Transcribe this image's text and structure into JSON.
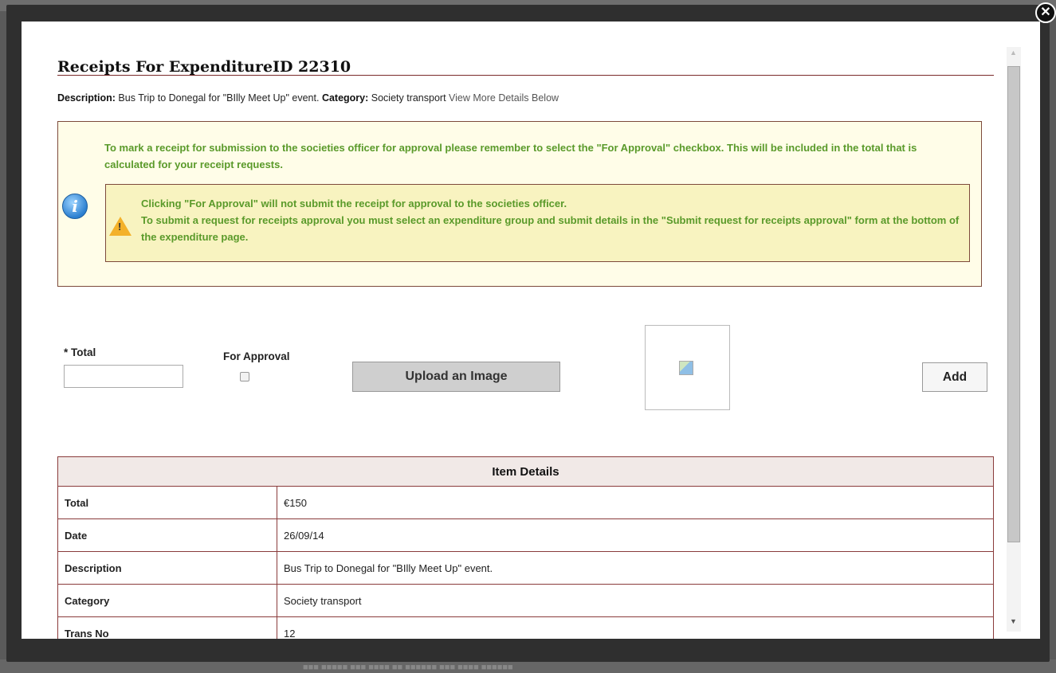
{
  "background": {
    "footer_text": "■■■ ■■■■■ ■■■ ■■■■ ■■ ■■■■■■ ■■■ ■■■■ ■■■■■■"
  },
  "modal": {
    "close_symbol": "✕",
    "title": "Receipts For ExpenditureID 22310",
    "description_label": "Description:",
    "description_value": " Bus Trip to Donegal for \"BIlly Meet Up\" event. ",
    "category_label": "Category:",
    "category_value": " Society transport ",
    "view_more_link": "View More Details Below",
    "info_text": "To mark a receipt for submission to the societies officer for approval please remember to select the \"For Approval\" checkbox. This will be included in the total that is calculated for your receipt requests.",
    "warning_line1": "Clicking \"For Approval\" will not submit the receipt for approval to the societies officer.",
    "warning_line2": "To submit a request for receipts approval you must select an expenditure group and submit details in the \"Submit request for receipts approval\" form at the bottom of the expenditure page.",
    "icons": {
      "info": "i",
      "warning": "!"
    }
  },
  "form": {
    "total_label": "* Total",
    "total_value": "",
    "for_approval_label": "For Approval",
    "for_approval_checked": false,
    "upload_button": "Upload an Image",
    "add_button": "Add"
  },
  "details": {
    "header": "Item Details",
    "rows": [
      {
        "label": "Total",
        "value": "€150"
      },
      {
        "label": "Date",
        "value": "26/09/14"
      },
      {
        "label": "Description",
        "value": "Bus Trip to Donegal for \"BIlly Meet Up\" event."
      },
      {
        "label": "Category",
        "value": "Society transport"
      },
      {
        "label": "Trans No",
        "value": "12"
      }
    ]
  },
  "scrollbar": {
    "up": "▲",
    "down": "▼"
  }
}
